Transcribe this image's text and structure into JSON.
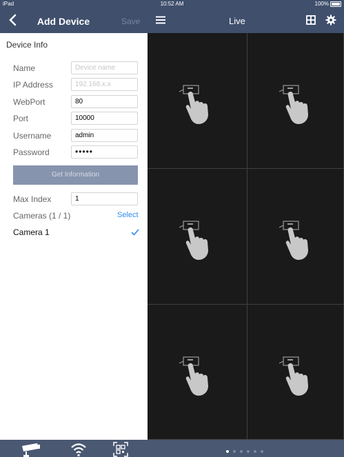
{
  "statusbar": {
    "device": "iPad",
    "time": "10:52 AM",
    "battery": "100%"
  },
  "nav": {
    "title": "Add Device",
    "save_label": "Save"
  },
  "live_nav": {
    "title": "Live"
  },
  "form": {
    "section_title": "Device Info",
    "fields": [
      {
        "label": "Name",
        "value": "",
        "placeholder": "Device name"
      },
      {
        "label": "IP Address",
        "value": "",
        "placeholder": "192.168.x.x"
      },
      {
        "label": "WebPort",
        "value": "80",
        "placeholder": ""
      },
      {
        "label": "Port",
        "value": "10000",
        "placeholder": ""
      },
      {
        "label": "Username",
        "value": "admin",
        "placeholder": ""
      },
      {
        "label": "Password",
        "value": "•••••",
        "placeholder": ""
      }
    ],
    "get_info_label": "Get Information",
    "max_index_label": "Max Index",
    "max_index_value": "1",
    "cameras_label": "Cameras (1 / 1)",
    "select_label": "Select",
    "cameras": [
      {
        "name": "Camera 1",
        "checked": true
      }
    ]
  },
  "live_grid": {
    "rows": 3,
    "cols": 2,
    "cell_icon": "tap-to-add-hand-icon"
  },
  "pager": {
    "pages": 6,
    "active_page": 1
  },
  "colors": {
    "nav_bg": "#3f4f6c",
    "accent": "#2d8cf0",
    "button_bg": "#8794ad"
  }
}
